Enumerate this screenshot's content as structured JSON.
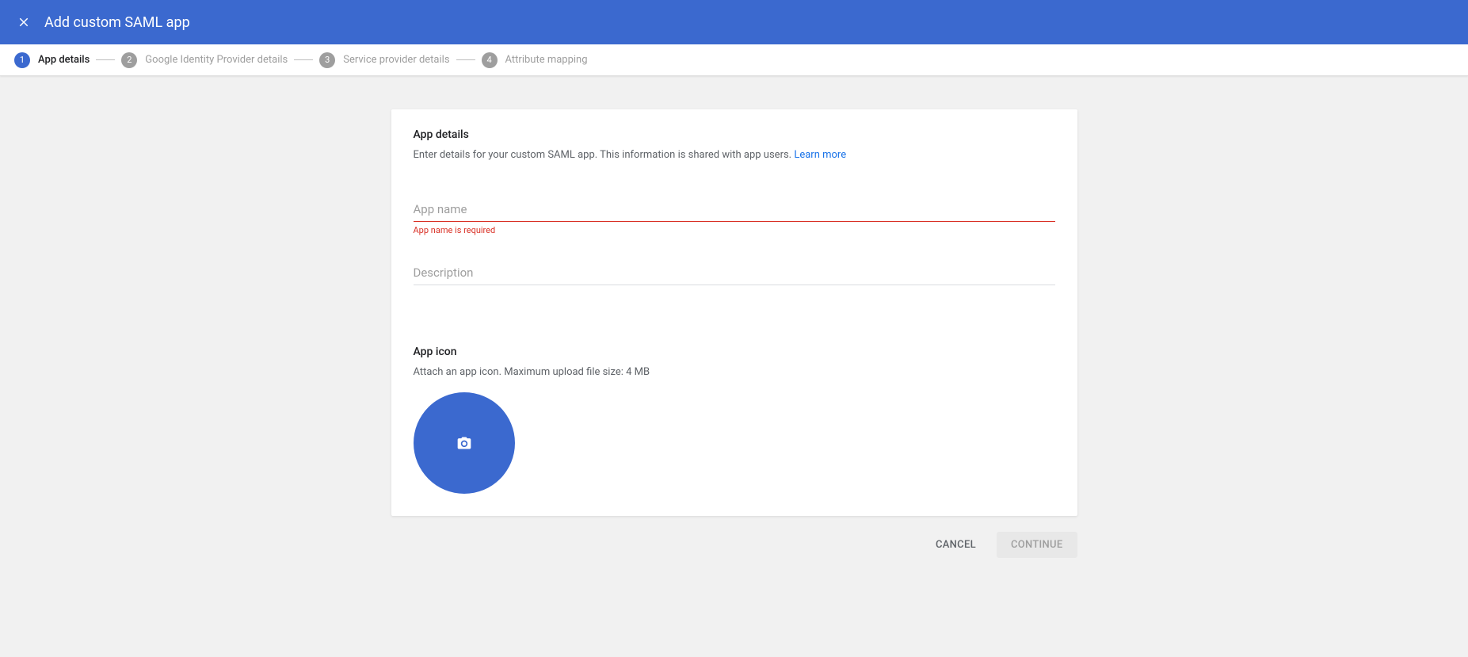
{
  "header": {
    "title": "Add custom SAML app"
  },
  "stepper": {
    "steps": [
      {
        "num": "1",
        "label": "App details"
      },
      {
        "num": "2",
        "label": "Google Identity Provider details"
      },
      {
        "num": "3",
        "label": "Service provider details"
      },
      {
        "num": "4",
        "label": "Attribute mapping"
      }
    ]
  },
  "card": {
    "section1": {
      "title": "App details",
      "desc": "Enter details for your custom SAML app. This information is shared with app users. ",
      "learn_more": "Learn more"
    },
    "app_name": {
      "placeholder": "App name",
      "value": "",
      "error": "App name is required"
    },
    "description": {
      "placeholder": "Description",
      "value": ""
    },
    "section2": {
      "title": "App icon",
      "desc": "Attach an app icon. Maximum upload file size: 4 MB"
    }
  },
  "footer": {
    "cancel": "CANCEL",
    "continue": "CONTINUE"
  }
}
